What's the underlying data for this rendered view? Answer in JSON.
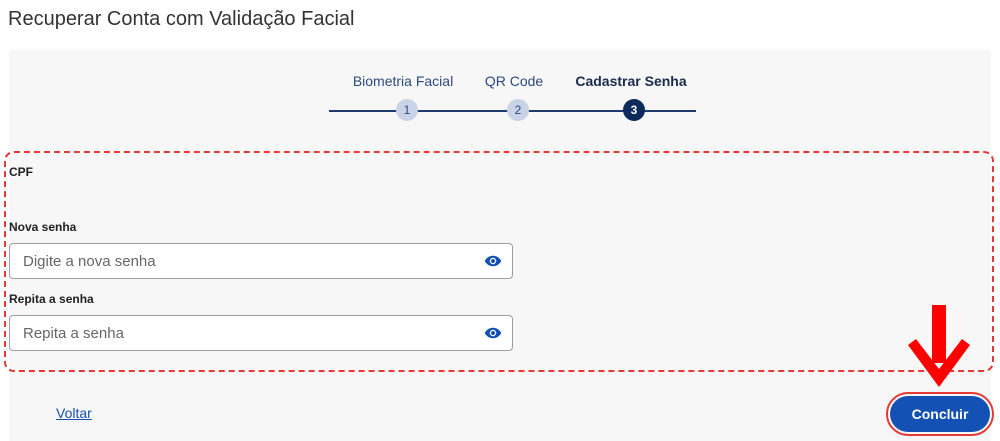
{
  "page": {
    "title": "Recuperar Conta com Validação Facial"
  },
  "stepper": {
    "steps": [
      {
        "label": "Biometria Facial",
        "number": "1",
        "active": false
      },
      {
        "label": "QR Code",
        "number": "2",
        "active": false
      },
      {
        "label": "Cadastrar Senha",
        "number": "3",
        "active": true
      }
    ]
  },
  "form": {
    "cpf_label": "CPF",
    "new_password": {
      "label": "Nova senha",
      "placeholder": "Digite a nova senha",
      "value": ""
    },
    "repeat_password": {
      "label": "Repita a senha",
      "placeholder": "Repita a senha",
      "value": ""
    }
  },
  "footer": {
    "back_label": "Voltar",
    "conclude_label": "Concluir"
  },
  "colors": {
    "primary": "#1351b4",
    "step_active": "#0c2b5c",
    "step_inactive": "#c8d4e6",
    "highlight": "#e53935"
  },
  "icons": {
    "password_toggle": "eye-icon",
    "annotation": "arrow-down-icon"
  }
}
